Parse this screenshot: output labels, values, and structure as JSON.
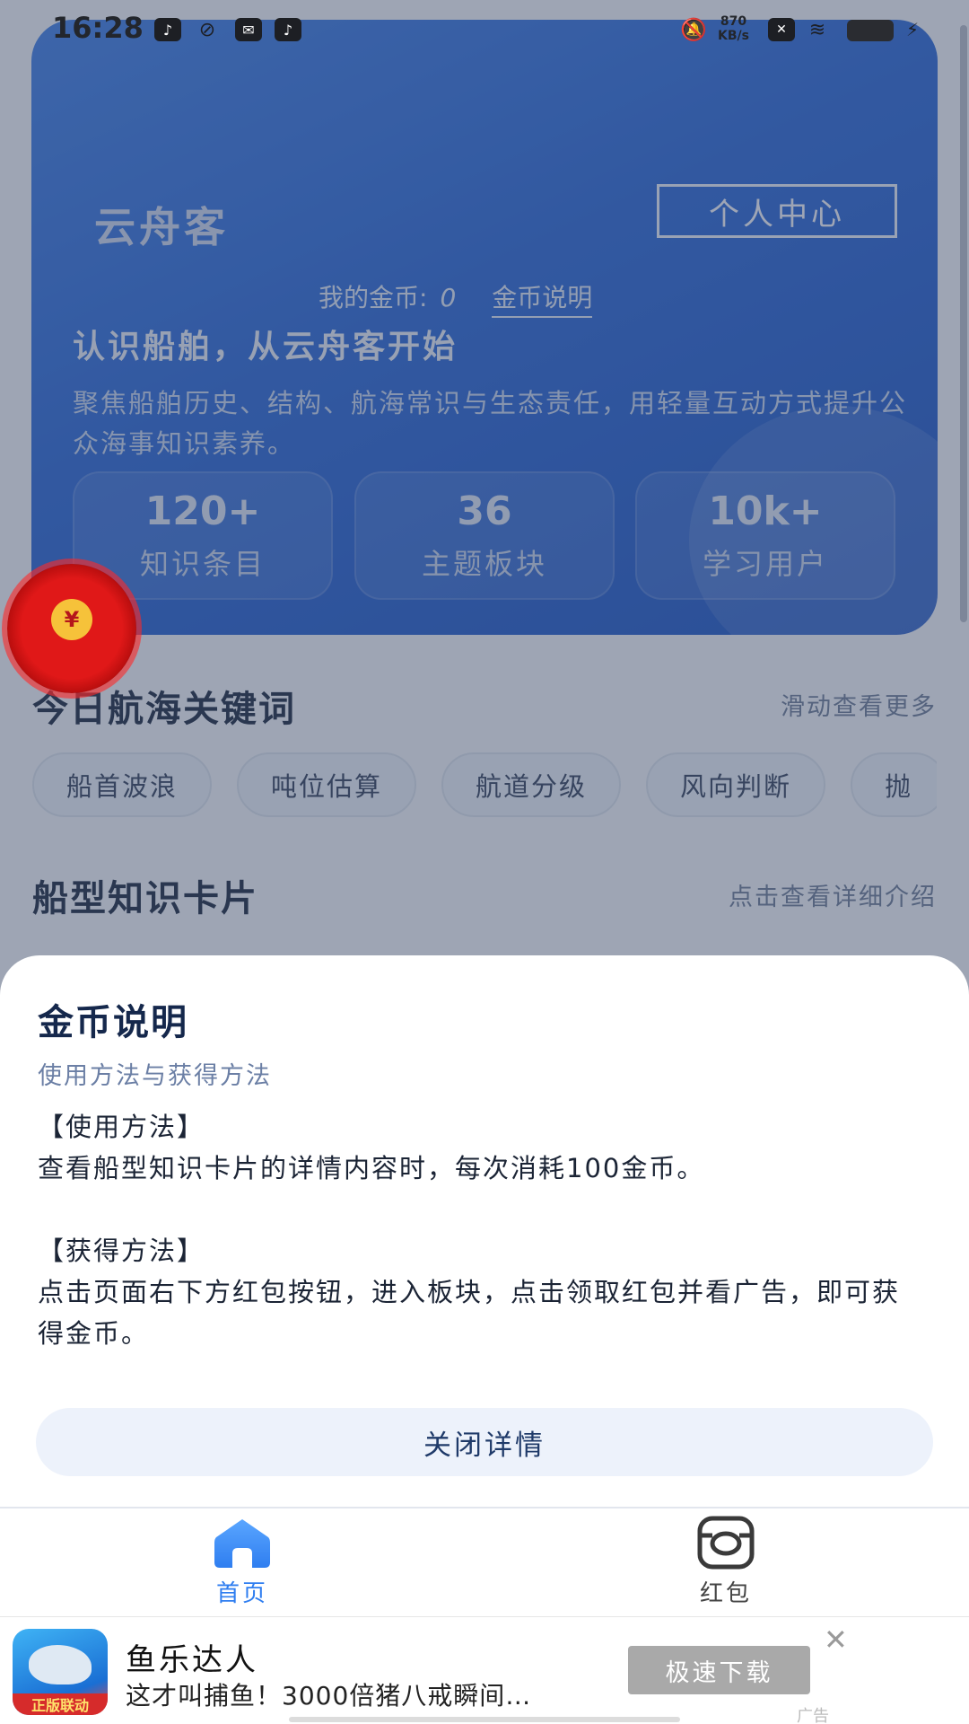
{
  "status_bar": {
    "time": "16:28",
    "net_speed": "870\nKB/s"
  },
  "hero": {
    "app_name": "云舟客",
    "profile_button": "个人中心",
    "coins_label": "我的金币:",
    "coins_value": "0",
    "coins_info_link": "金币说明",
    "headline": "认识船舶，从云舟客开始",
    "description": "聚焦船舶历史、结构、航海常识与生态责任，用轻量互动方式提升公众海事知识素养。",
    "stats": [
      {
        "value": "120+",
        "label": "知识条目"
      },
      {
        "value": "36",
        "label": "主题板块"
      },
      {
        "value": "10k+",
        "label": "学习用户"
      }
    ]
  },
  "keywords_section": {
    "title": "今日航海关键词",
    "hint": "滑动查看更多",
    "chips": [
      "船首波浪",
      "吨位估算",
      "航道分级",
      "风向判断",
      "抛"
    ]
  },
  "cards_section": {
    "title": "船型知识卡片",
    "hint": "点击查看详细介绍"
  },
  "sheet": {
    "title": "金币说明",
    "subtitle": "使用方法与获得方法",
    "use_heading": "【使用方法】",
    "use_text": "查看船型知识卡片的详情内容时，每次消耗100金币。",
    "earn_heading": "【获得方法】",
    "earn_text": "点击页面右下方红包按钮，进入板块，点击领取红包并看广告，即可获得金币。",
    "close_button": "关闭详情"
  },
  "tabbar": {
    "home_label": "首页",
    "redpacket_label": "红包",
    "active_color": "#2f7ef0"
  },
  "ad": {
    "title": "鱼乐达人",
    "description": "这才叫捕鱼！3000倍猪八戒瞬间…",
    "download_button": "极速下载",
    "icon_band": "正版联动",
    "tag": "广告"
  }
}
